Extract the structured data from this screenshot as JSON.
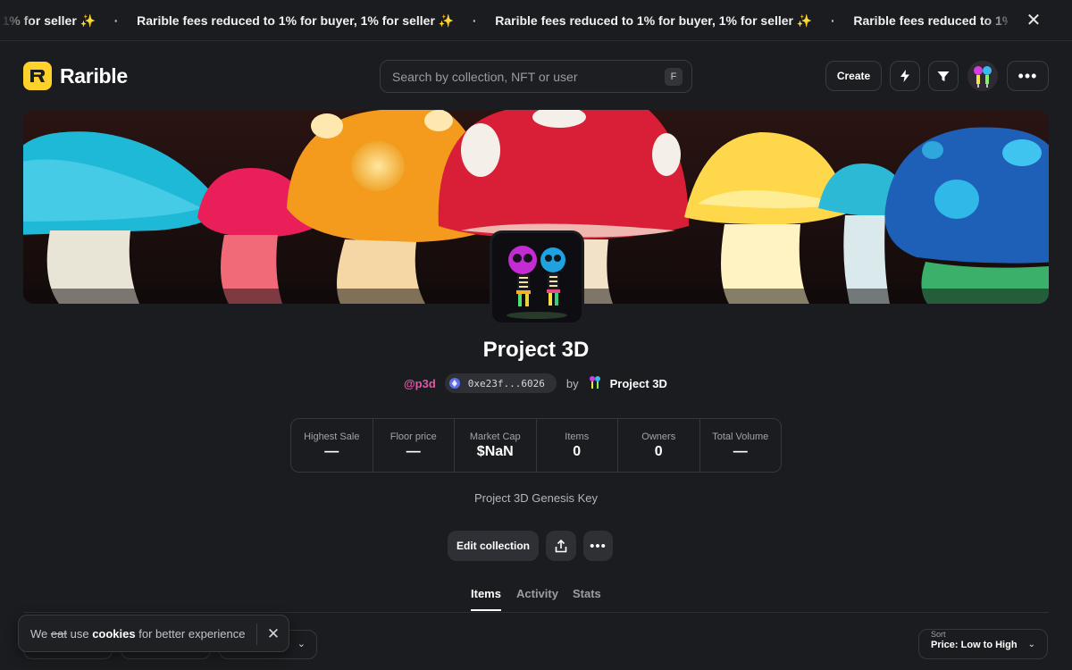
{
  "ticker": {
    "message": "Rarible fees reduced to 1% for buyer, 1% for seller ✨",
    "separator": "·",
    "close_icon": "close-icon"
  },
  "header": {
    "brand": "Rarible",
    "search": {
      "placeholder": "Search by collection, NFT or user",
      "shortcut": "F"
    },
    "create_label": "Create",
    "icons": {
      "bolt": "bolt-icon",
      "filter": "filter-icon",
      "more": "more-icon",
      "avatar": "user-avatar"
    },
    "more_label": "•••"
  },
  "collection": {
    "name": "Project 3D",
    "handle": "@p3d",
    "address": "0xe23f...6026",
    "by_label": "by",
    "creator": "Project 3D",
    "description": "Project 3D Genesis Key"
  },
  "stats": [
    {
      "label": "Highest Sale",
      "value": "—"
    },
    {
      "label": "Floor price",
      "value": "—"
    },
    {
      "label": "Market Cap",
      "value": "$NaN"
    },
    {
      "label": "Items",
      "value": "0"
    },
    {
      "label": "Owners",
      "value": "0"
    },
    {
      "label": "Total Volume",
      "value": "—"
    }
  ],
  "actions": {
    "edit_label": "Edit collection",
    "share_icon": "share-icon",
    "more_label": "•••"
  },
  "tabs": [
    {
      "label": "Items",
      "active": true
    },
    {
      "label": "Activity",
      "active": false
    },
    {
      "label": "Stats",
      "active": false
    }
  ],
  "sort": {
    "label": "Sort",
    "value": "Price: Low to High"
  },
  "cookie": {
    "prefix": "We",
    "struck": "eat",
    "middle": "use",
    "bold": "cookies",
    "suffix": "for better experience"
  },
  "colors": {
    "background": "#1b1c1f",
    "brand_yellow": "#fed22b",
    "handle_pink": "#e455a8"
  }
}
